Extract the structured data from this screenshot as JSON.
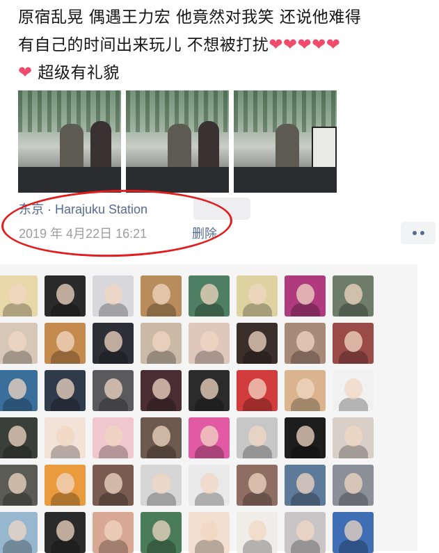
{
  "post": {
    "text_line1": "原宿乱晃 偶遇王力宏  他竟然对我笑  还说他难得",
    "text_line2": "有自己的时间出来玩儿  不想被打扰",
    "text_line3_tail": "超级有礼貌",
    "hearts_line2": "❤❤❤❤❤",
    "hearts_line3": "❤"
  },
  "photos": [
    {
      "name": "photo-1"
    },
    {
      "name": "photo-2"
    },
    {
      "name": "photo-3"
    }
  ],
  "meta": {
    "location": "东京 · Harajuku Station",
    "time": "2019 年 4月22日 16:21",
    "delete_label": "删除"
  },
  "likes": {
    "avatar_colors": [
      [
        "#e8d7a8",
        "#2a2a2a",
        "#d8d8dc",
        "#b98c5c",
        "#4e7f62",
        "#ded3a0",
        "#b03a7e",
        "#6d7d6a"
      ],
      [
        "#d7c7b7",
        "#c58a4d",
        "#2e2f36",
        "#c9b9a6",
        "#e0c7bc",
        "#3b2f2b",
        "#a88a78",
        "#9a4b47"
      ],
      [
        "#3a6f9c",
        "#2f3a4a",
        "#5a5a5c",
        "#4a2e33",
        "#2b2b2b",
        "#d23c3c",
        "#d9b48e",
        "#f1f1f1"
      ],
      [
        "#3b3f3a",
        "#f3e2d8",
        "#f0c7cc",
        "#6d5a4e",
        "#e25aa3",
        "#c7c7c7",
        "#1d1d1d",
        "#d9cfc9"
      ],
      [
        "#5b5b55",
        "#e99b3e",
        "#7a5b50",
        "#d6d6d6",
        "#e9e9e9",
        "#8e6d63",
        "#5e7a99",
        "#8a8f99"
      ],
      [
        "#97b7cf",
        "#2a2a2a",
        "#d8a894",
        "#4b7c5a",
        "#f2dfd0",
        "#f0ede8",
        "#c9c5c7",
        "#3f6eb5"
      ]
    ]
  }
}
